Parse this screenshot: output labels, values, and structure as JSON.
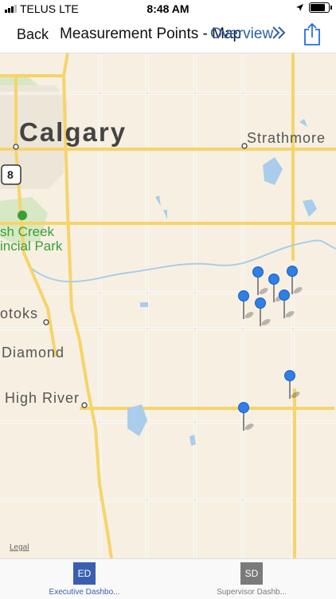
{
  "status": {
    "carrier": "TELUS",
    "network": "LTE",
    "time": "8:48 AM"
  },
  "nav": {
    "back": "Back",
    "title": "Measurement Points - Map",
    "overview": "Overview",
    "overview_chevron": "chevron-double-right-icon",
    "share": "share-icon"
  },
  "map": {
    "labels": {
      "calgary": "Calgary",
      "strathmore": "Strathmore",
      "okotoks": "otoks",
      "diamond": "Diamond",
      "high_river": "High River",
      "park_line1": "sh Creek",
      "park_line2": "incial Park",
      "highway": "8"
    },
    "legal": "Legal",
    "pin_count": 8
  },
  "tabs": [
    {
      "abbr": "ED",
      "label": "Executive Dashbo...",
      "color": "#3a5fb0",
      "selected": true
    },
    {
      "abbr": "SD",
      "label": "Supervisor Dashb...",
      "color": "#7a7a7a",
      "selected": false
    }
  ]
}
